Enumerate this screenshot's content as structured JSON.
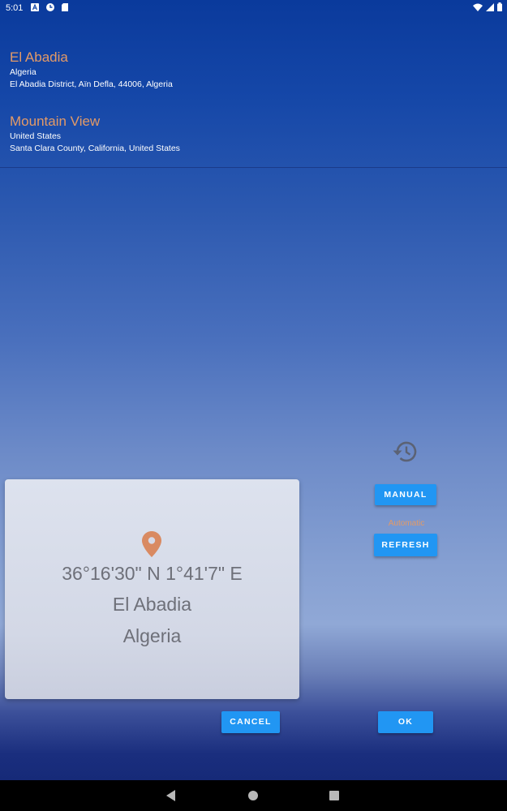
{
  "status_bar": {
    "time": "5:01",
    "left_icons": [
      "font-icon",
      "clock-app-icon",
      "sd-card-icon"
    ],
    "right_icons": [
      "wifi-icon",
      "cell-signal-icon",
      "battery-icon"
    ]
  },
  "history": {
    "items": [
      {
        "name": "El Abadia",
        "country": "Algeria",
        "address": "El Abadia District, Aïn Defla, 44006, Algeria"
      },
      {
        "name": "Mountain View",
        "country": "United States",
        "address": "Santa Clara County, California, United States"
      }
    ]
  },
  "location_card": {
    "icon": "location-pin-icon",
    "coordinates": "36°16'30\" N 1°41'7\" E",
    "city": "El Abadia",
    "country": "Algeria"
  },
  "controls": {
    "history_icon": "history-icon",
    "manual_label": "MANUAL",
    "automatic_label": "Automatic",
    "refresh_label": "REFRESH"
  },
  "dialog_buttons": {
    "cancel_label": "CANCEL",
    "ok_label": "OK"
  },
  "colors": {
    "accent_orange": "#e39a67",
    "button_blue": "#2196f3",
    "card_text": "#6e7079"
  },
  "nav_bar": {
    "icons": [
      "back-icon",
      "home-icon",
      "recents-icon"
    ]
  }
}
